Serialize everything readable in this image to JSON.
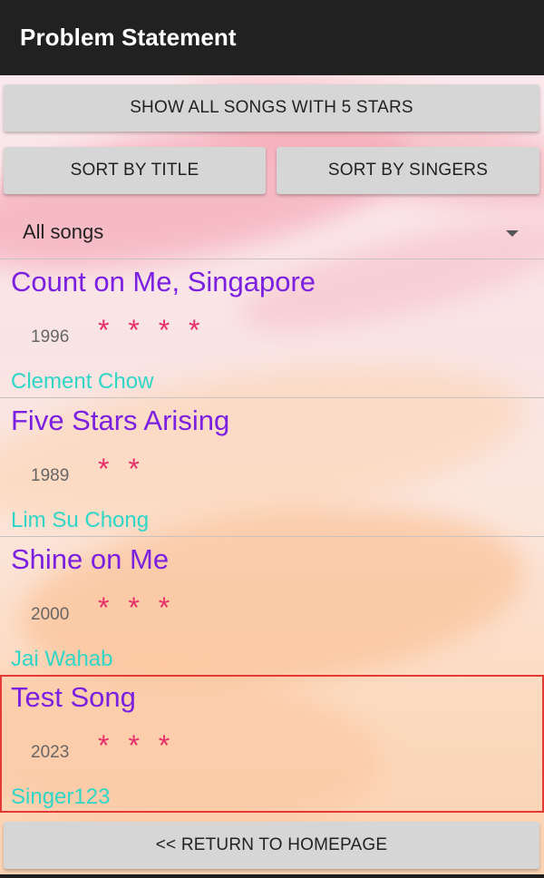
{
  "app": {
    "title": "Problem Statement"
  },
  "buttons": {
    "show_five_stars": "SHOW ALL SONGS WITH 5 STARS",
    "sort_by_title": "SORT BY TITLE",
    "sort_by_singers": "SORT BY SINGERS",
    "return_homepage": "<< RETURN TO HOMEPAGE"
  },
  "filter": {
    "selected": "All songs"
  },
  "songs": [
    {
      "title": "Count on Me, Singapore",
      "year": "1996",
      "stars": "* * * *",
      "singer": "Clement Chow",
      "selected": false
    },
    {
      "title": "Five Stars Arising",
      "year": "1989",
      "stars": "* *",
      "singer": "Lim Su Chong",
      "selected": false
    },
    {
      "title": "Shine on Me",
      "year": "2000",
      "stars": "* * *",
      "singer": "Jai Wahab",
      "selected": false
    },
    {
      "title": "Test Song",
      "year": "2023",
      "stars": "* * *",
      "singer": "Singer123",
      "selected": true
    }
  ],
  "colors": {
    "app_bar": "#212121",
    "title_text": "#7b1fe0",
    "stars": "#e5306a",
    "singer_text": "#2fd6c8",
    "selected_border": "#e53935",
    "button_bg": "#d6d6d6"
  }
}
